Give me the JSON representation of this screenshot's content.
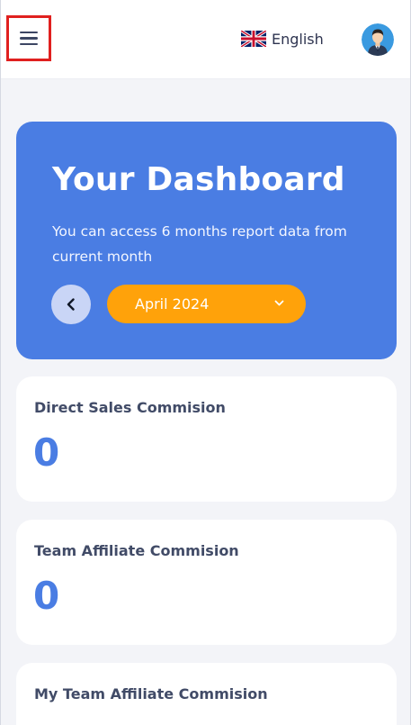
{
  "header": {
    "language": "English",
    "menu_icon": "hamburger-menu-icon",
    "flag_icon": "uk-flag-icon",
    "avatar_icon": "user-avatar-icon"
  },
  "hero": {
    "title": "Your Dashboard",
    "subtitle": "You can access 6 months report data from current month",
    "selected_month": "April 2024",
    "prev_icon": "chevron-left-icon",
    "dropdown_icon": "chevron-down-icon"
  },
  "cards": [
    {
      "title": "Direct Sales Commision",
      "value": "0"
    },
    {
      "title": "Team Affiliate Commision",
      "value": "0"
    },
    {
      "title": "My Team Affiliate Commision",
      "value": ""
    }
  ],
  "colors": {
    "primary": "#4a7de3",
    "accent": "#ffa20a",
    "background": "#f3f4f8",
    "highlight_border": "#e0201f"
  }
}
